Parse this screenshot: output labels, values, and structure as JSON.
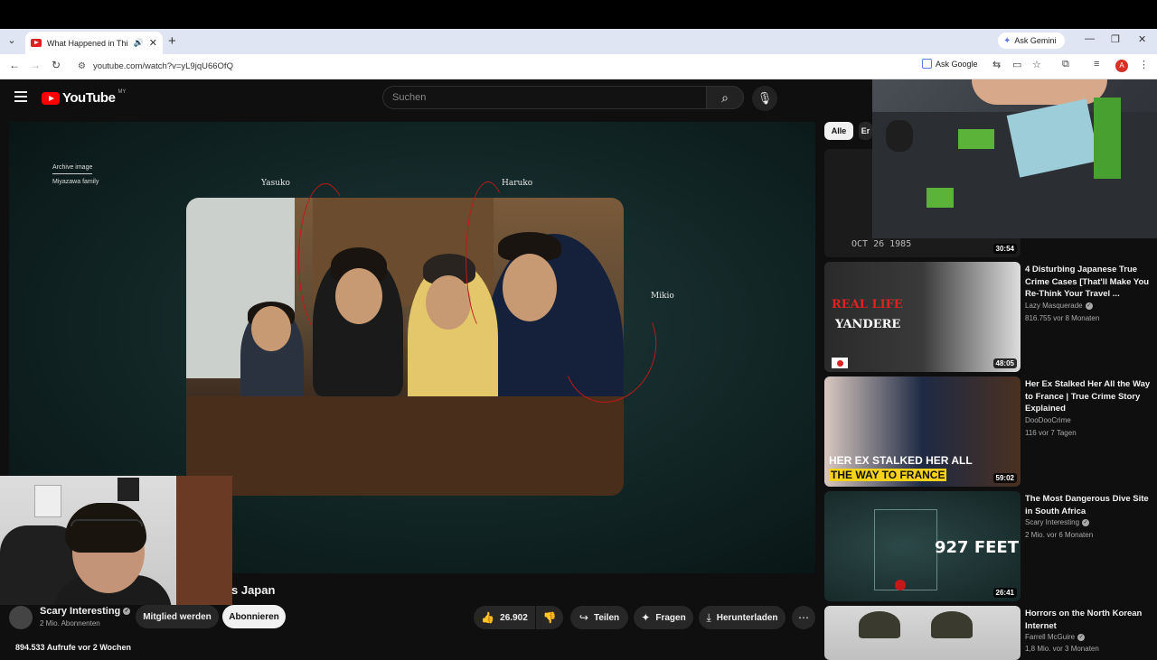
{
  "browser": {
    "tab_title": "What Happened in This Ho",
    "ask_gemini": "Ask Gemini",
    "url": "youtube.com/watch?v=yL9jqU66OfQ",
    "ask_google": "Ask Google",
    "avatar_letter": "A"
  },
  "youtube": {
    "logo": "YouTube",
    "country": "MY",
    "search_placeholder": "Suchen"
  },
  "video": {
    "archive_line1": "Archive image",
    "archive_line2": "Miyazawa family",
    "labels": {
      "yasuko": "Yasuko",
      "haruko": "Haruko",
      "mikio": "Mikio"
    },
    "title_fragment": "s Japan",
    "channel": "Scary Interesting",
    "subs": "2 Mio. Abonnenten",
    "member_btn": "Mitglied werden",
    "subscribe_btn": "Abonnieren",
    "likes": "26.902",
    "share": "Teilen",
    "ask": "Fragen",
    "download": "Herunterladen",
    "views": "894.533 Aufrufe  vor 2 Wochen"
  },
  "chips": {
    "all": "Alle",
    "next": "Er"
  },
  "recommendations": [
    {
      "duration": "30:54",
      "thumb_text": "OCT 26 1985"
    },
    {
      "title": "4 Disturbing Japanese True Crime Cases [That'll Make You Re-Think Your Travel ...",
      "channel": "Lazy Masquerade",
      "meta": "816.755  vor 8 Monaten",
      "duration": "48:05",
      "thumb_text1": "REAL LIFE",
      "thumb_text2": "YANDERE"
    },
    {
      "title": "Her Ex Stalked Her All the Way to France | True Crime Story Explained",
      "channel": "DooDooCrime",
      "meta": "116  vor 7 Tagen",
      "duration": "59:02",
      "thumb_text1": "HER EX STALKED HER ALL",
      "thumb_text2": "THE WAY TO FRANCE"
    },
    {
      "title": "The Most Dangerous Dive Site in South Africa",
      "channel": "Scary Interesting",
      "meta": "2 Mio.  vor 6 Monaten",
      "duration": "26:41",
      "thumb_text1": "927 FEET"
    },
    {
      "title": "Horrors on the North Korean Internet",
      "channel": "Farrell McGuire",
      "meta": "1,8 Mio.  vor 3 Monaten"
    }
  ],
  "colors": {
    "accent_red": "#ff0000",
    "bg": "#0f0f0f",
    "annotation_red": "#c21818"
  }
}
